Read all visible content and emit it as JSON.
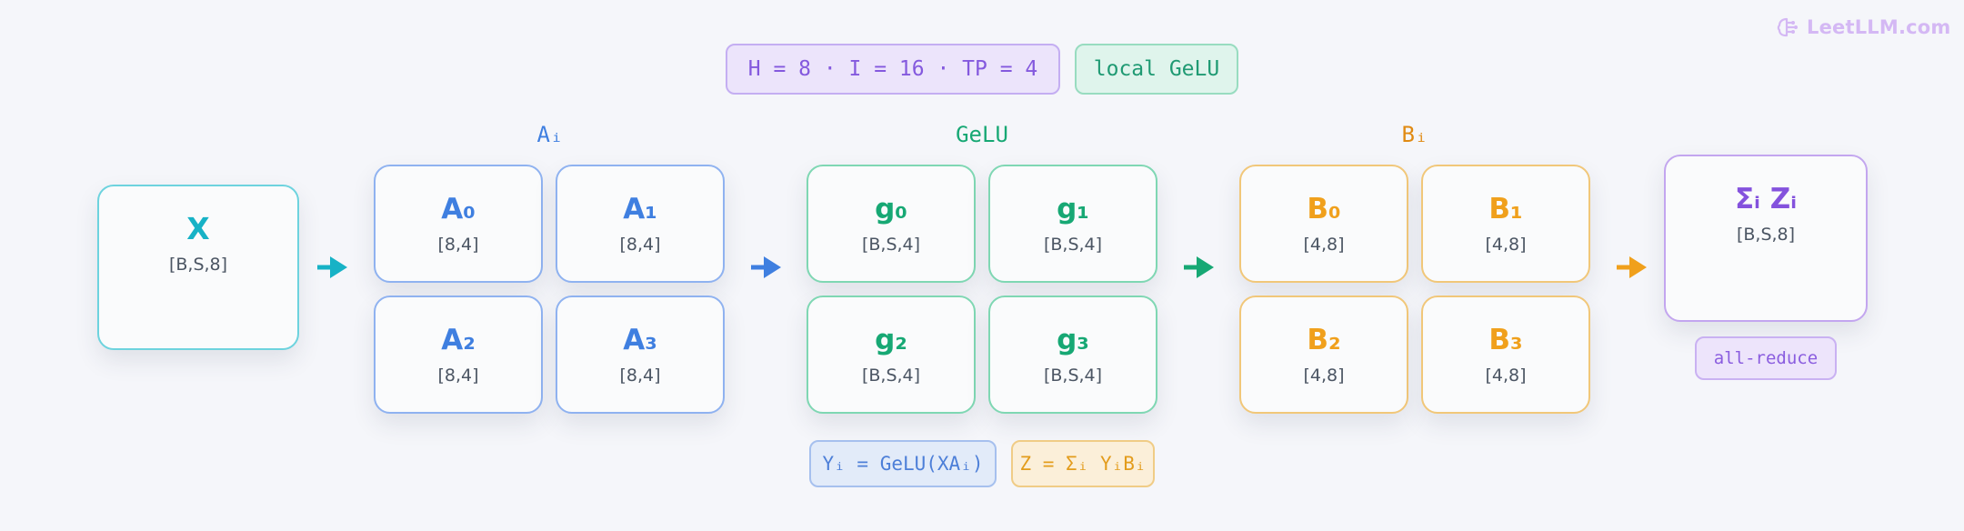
{
  "brand": {
    "text": "LeetLLM.com",
    "icon": "brain-icon",
    "color": "#d4b8f4"
  },
  "params_pill": "H = 8 · I = 16 · TP = 4",
  "gelu_pill": "local GeLU",
  "groups": {
    "a_label": "Aᵢ",
    "gelu_label": "GeLU",
    "b_label": "Bᵢ"
  },
  "x_box": {
    "name": "X",
    "dim": "[B,S,8]"
  },
  "a_cells": [
    {
      "name": "A₀",
      "dim": "[8,4]"
    },
    {
      "name": "A₁",
      "dim": "[8,4]"
    },
    {
      "name": "A₂",
      "dim": "[8,4]"
    },
    {
      "name": "A₃",
      "dim": "[8,4]"
    }
  ],
  "g_cells": [
    {
      "name": "g₀",
      "dim": "[B,S,4]"
    },
    {
      "name": "g₁",
      "dim": "[B,S,4]"
    },
    {
      "name": "g₂",
      "dim": "[B,S,4]"
    },
    {
      "name": "g₃",
      "dim": "[B,S,4]"
    }
  ],
  "b_cells": [
    {
      "name": "B₀",
      "dim": "[4,8]"
    },
    {
      "name": "B₁",
      "dim": "[4,8]"
    },
    {
      "name": "B₂",
      "dim": "[4,8]"
    },
    {
      "name": "B₃",
      "dim": "[4,8]"
    }
  ],
  "sum_box": {
    "name": "Σᵢ Zᵢ",
    "dim": "[B,S,8]"
  },
  "all_reduce": "all-reduce",
  "formula_y": "Yᵢ = GeLU(XAᵢ)",
  "formula_z": "Z = Σᵢ YᵢBᵢ",
  "colors": {
    "x": "#17b2c6",
    "a": "#3f7fe0",
    "gelu": "#17a874",
    "b": "#f0a01c",
    "sum": "#8452dd"
  }
}
